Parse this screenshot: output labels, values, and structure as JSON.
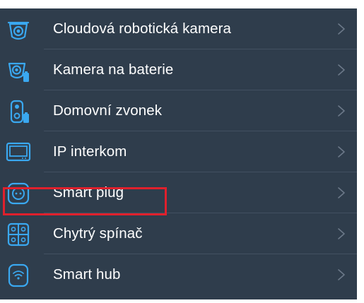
{
  "device_list": {
    "items": [
      {
        "label": "Cloudová robotická kamera",
        "icon": "robot-camera-icon"
      },
      {
        "label": "Kamera na baterie",
        "icon": "battery-camera-icon"
      },
      {
        "label": "Domovní zvonek",
        "icon": "doorbell-icon"
      },
      {
        "label": "IP interkom",
        "icon": "intercom-icon"
      },
      {
        "label": "Smart plug",
        "icon": "smart-plug-icon"
      },
      {
        "label": "Chytrý spínač",
        "icon": "smart-switch-icon"
      },
      {
        "label": "Smart hub",
        "icon": "smart-hub-icon"
      }
    ],
    "highlighted_item": "Smart plug"
  },
  "colors": {
    "background": "#2f3d4c",
    "icon_accent": "#3aa8f0",
    "text": "#ffffff",
    "chevron": "#6b7888",
    "highlight_border": "#e0202c"
  }
}
